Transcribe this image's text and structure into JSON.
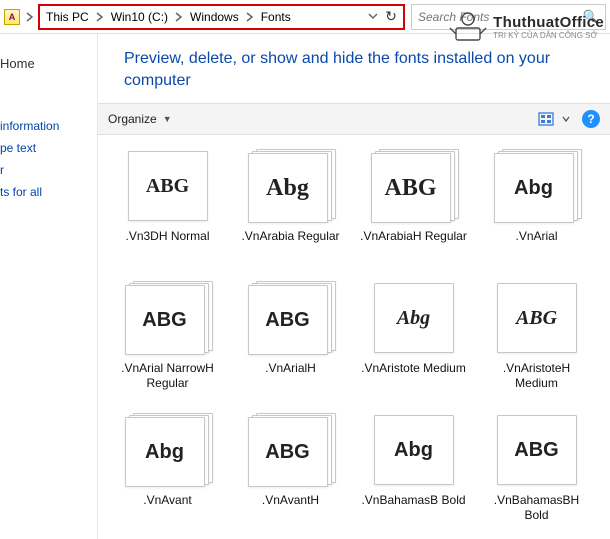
{
  "address": {
    "segments": [
      "This PC",
      "Win10 (C:)",
      "Windows",
      "Fonts"
    ]
  },
  "search": {
    "placeholder": "Search Fonts"
  },
  "sidebar": {
    "home": "Home",
    "links": [
      "information",
      "pe text",
      "r",
      "ts for all"
    ]
  },
  "heading": "Preview, delete, or show and hide the fonts installed on your computer",
  "organize": {
    "label": "Organize"
  },
  "fonts": [
    {
      "name": ".Vn3DH Normal",
      "sample": "ABG",
      "style": "serif",
      "multi": false
    },
    {
      "name": ".VnArabia Regular",
      "sample": "Abg",
      "style": "script",
      "multi": true
    },
    {
      "name": ".VnArabiaH Regular",
      "sample": "ABG",
      "style": "script",
      "multi": true
    },
    {
      "name": ".VnArial",
      "sample": "Abg",
      "style": "",
      "multi": true
    },
    {
      "name": ".VnArial NarrowH Regular",
      "sample": "ABG",
      "style": "",
      "multi": true
    },
    {
      "name": ".VnArialH",
      "sample": "ABG",
      "style": "",
      "multi": true
    },
    {
      "name": ".VnAristote Medium",
      "sample": "Abg",
      "style": "italic",
      "multi": false
    },
    {
      "name": ".VnAristoteH Medium",
      "sample": "ABG",
      "style": "italic",
      "multi": false
    },
    {
      "name": ".VnAvant",
      "sample": "Abg",
      "style": "",
      "multi": true
    },
    {
      "name": ".VnAvantH",
      "sample": "ABG",
      "style": "",
      "multi": true
    },
    {
      "name": ".VnBahamasB Bold",
      "sample": "Abg",
      "style": "",
      "multi": false
    },
    {
      "name": ".VnBahamasBH Bold",
      "sample": "ABG",
      "style": "",
      "multi": false
    }
  ],
  "logo": {
    "brand": "ThuthuatOffice",
    "tagline": "TRI KỶ CỦA DÂN CÔNG SỞ"
  }
}
